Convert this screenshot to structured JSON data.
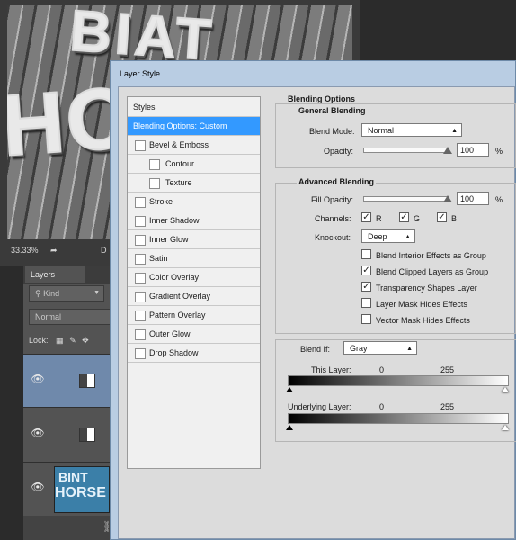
{
  "document": {
    "zoom": "33.33%",
    "status_extra": "D",
    "artwork_words": [
      "BIAT",
      "HORS"
    ]
  },
  "layers_panel": {
    "tab": "Layers",
    "filter_kind": "Kind",
    "blend_mode": "Normal",
    "lock_label": "Lock:",
    "layers": [
      {
        "visible": true,
        "selected": true
      },
      {
        "visible": true,
        "selected": false
      },
      {
        "visible": true,
        "selected": false,
        "thumbnail_words": [
          "BINT",
          "HORSE"
        ]
      }
    ]
  },
  "dialog": {
    "title": "Layer Style",
    "styles_header": "Styles",
    "style_items": [
      {
        "label": "Blending Options: Custom",
        "has_checkbox": false,
        "indent": false,
        "selected": true
      },
      {
        "label": "Bevel & Emboss",
        "has_checkbox": true,
        "indent": false
      },
      {
        "label": "Contour",
        "has_checkbox": true,
        "indent": true
      },
      {
        "label": "Texture",
        "has_checkbox": true,
        "indent": true
      },
      {
        "label": "Stroke",
        "has_checkbox": true,
        "indent": false
      },
      {
        "label": "Inner Shadow",
        "has_checkbox": true,
        "indent": false
      },
      {
        "label": "Inner Glow",
        "has_checkbox": true,
        "indent": false
      },
      {
        "label": "Satin",
        "has_checkbox": true,
        "indent": false
      },
      {
        "label": "Color Overlay",
        "has_checkbox": true,
        "indent": false
      },
      {
        "label": "Gradient Overlay",
        "has_checkbox": true,
        "indent": false
      },
      {
        "label": "Pattern Overlay",
        "has_checkbox": true,
        "indent": false
      },
      {
        "label": "Outer Glow",
        "has_checkbox": true,
        "indent": false
      },
      {
        "label": "Drop Shadow",
        "has_checkbox": true,
        "indent": false
      }
    ],
    "blending_options": {
      "section_title": "Blending Options",
      "general": {
        "title": "General Blending",
        "blend_mode_label": "Blend Mode:",
        "blend_mode_value": "Normal",
        "opacity_label": "Opacity:",
        "opacity_value": "100",
        "opacity_unit": "%",
        "opacity_level": 1.0
      },
      "advanced": {
        "title": "Advanced Blending",
        "fill_opacity_label": "Fill Opacity:",
        "fill_opacity_value": "100",
        "fill_opacity_unit": "%",
        "fill_opacity_level": 1.0,
        "channels_label": "Channels:",
        "channels": [
          {
            "label": "R",
            "checked": true
          },
          {
            "label": "G",
            "checked": true
          },
          {
            "label": "B",
            "checked": true
          }
        ],
        "knockout_label": "Knockout:",
        "knockout_value": "Deep",
        "options": [
          {
            "label": "Blend Interior Effects as Group",
            "checked": false
          },
          {
            "label": "Blend Clipped Layers as Group",
            "checked": true
          },
          {
            "label": "Transparency Shapes Layer",
            "checked": true
          },
          {
            "label": "Layer Mask Hides Effects",
            "checked": false
          },
          {
            "label": "Vector Mask Hides Effects",
            "checked": false
          }
        ]
      },
      "blend_if": {
        "label": "Blend If:",
        "value": "Gray",
        "this_layer_label": "This Layer:",
        "this_layer_low": "0",
        "this_layer_high": "255",
        "underlying_label": "Underlying Layer:",
        "underlying_low": "0",
        "underlying_high": "255"
      }
    }
  }
}
